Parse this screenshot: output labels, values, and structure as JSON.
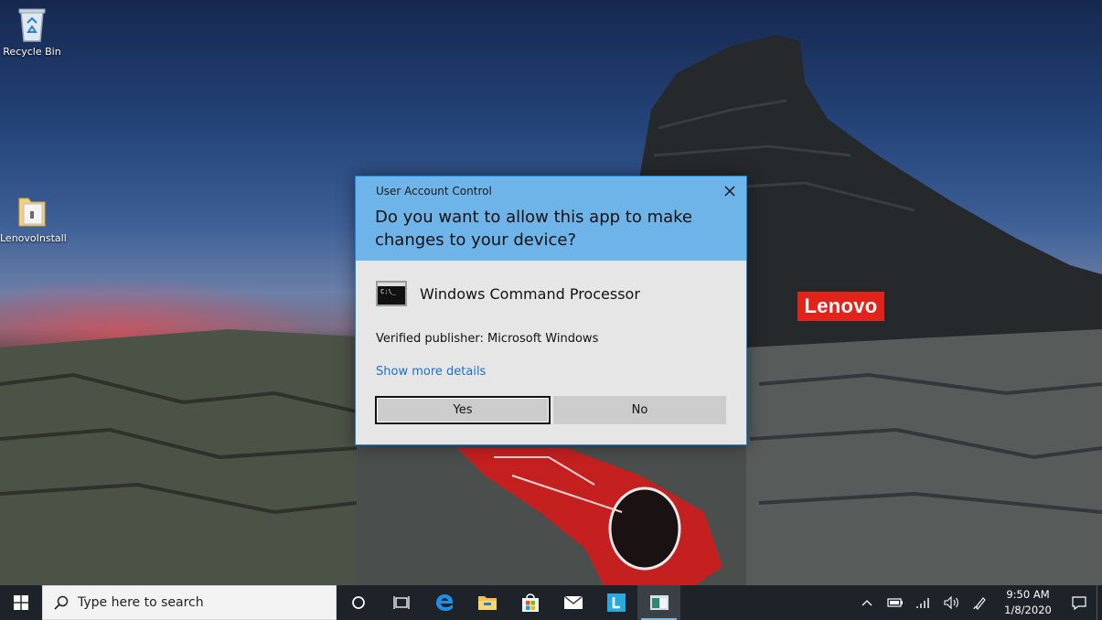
{
  "desktop": {
    "icons": [
      {
        "label": "Recycle Bin",
        "icon": "recycle-bin-icon"
      },
      {
        "label": "LenovoInstall",
        "icon": "folder-icon"
      }
    ],
    "brand_logo": "Lenovo"
  },
  "dialog": {
    "title": "User Account Control",
    "question": "Do you want to allow this app to make changes to your device?",
    "app_name": "Windows Command Processor",
    "publisher": "Verified publisher: Microsoft Windows",
    "details_link": "Show more details",
    "yes_label": "Yes",
    "no_label": "No",
    "header_color": "#6fb4e9",
    "link_color": "#1e6fc9"
  },
  "taskbar": {
    "search_placeholder": "Type here to search",
    "pinned": [
      "cortana-icon",
      "task-view-icon",
      "edge-icon",
      "file-explorer-icon",
      "store-icon",
      "mail-icon",
      "lenovo-vantage-icon",
      "command-prompt-icon"
    ],
    "tray": [
      "chevron-up-icon",
      "battery-icon",
      "wifi-icon",
      "volume-icon",
      "pen-icon"
    ],
    "time": "9:50 AM",
    "date": "1/8/2020"
  }
}
